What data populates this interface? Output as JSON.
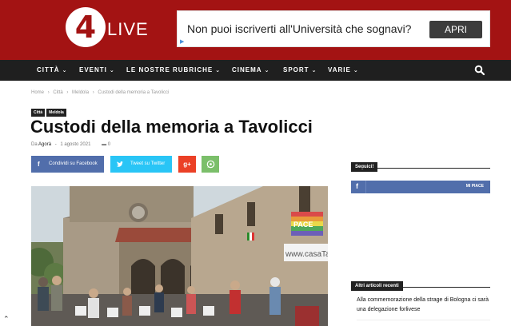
{
  "brand": {
    "digit": "4",
    "word": "LIVE",
    "color": "#a31313"
  },
  "ad": {
    "text": "Non puoi iscriverti all'Università che sognavi?",
    "button": "APRI",
    "info_icon": "play-triangle-icon"
  },
  "nav": {
    "items": [
      {
        "label": "CITTÀ"
      },
      {
        "label": "EVENTI"
      },
      {
        "label": "LE NOSTRE RUBRICHE"
      },
      {
        "label": "CINEMA"
      },
      {
        "label": "SPORT"
      },
      {
        "label": "VARIE"
      }
    ],
    "search_icon": "search-icon"
  },
  "breadcrumb": {
    "home": "Home",
    "section": "Città",
    "subsection": "Meldola",
    "current": "Custodi della memoria a Tavolicci",
    "separator": "›"
  },
  "tags": [
    "Città",
    "Meldola"
  ],
  "article": {
    "title": "Custodi della memoria a Tavolicci",
    "by": "Da",
    "author": "Agorà",
    "date": "1 agosto 2021",
    "comments": "0"
  },
  "share": {
    "facebook": "Condividi su Facebook",
    "twitter": "Tweet su Twitter",
    "gplus": "g+",
    "whatsapp": "whatsapp-icon"
  },
  "photo": {
    "banner_text": "www.casaTag",
    "flag_text": "PACE"
  },
  "sidebar": {
    "follow_title": "Seguici!",
    "fb_like": "MI PIACE",
    "recent_title": "Altri articoli recenti",
    "recent_article": "Alla commemorazione della strage di Bologna ci sarà una delegazione forlivese"
  },
  "colors": {
    "facebook": "#516eab",
    "twitter": "#29c5f6",
    "gplus": "#eb4026",
    "whatsapp": "#7bbf6a",
    "nav": "#1f1f1f"
  }
}
